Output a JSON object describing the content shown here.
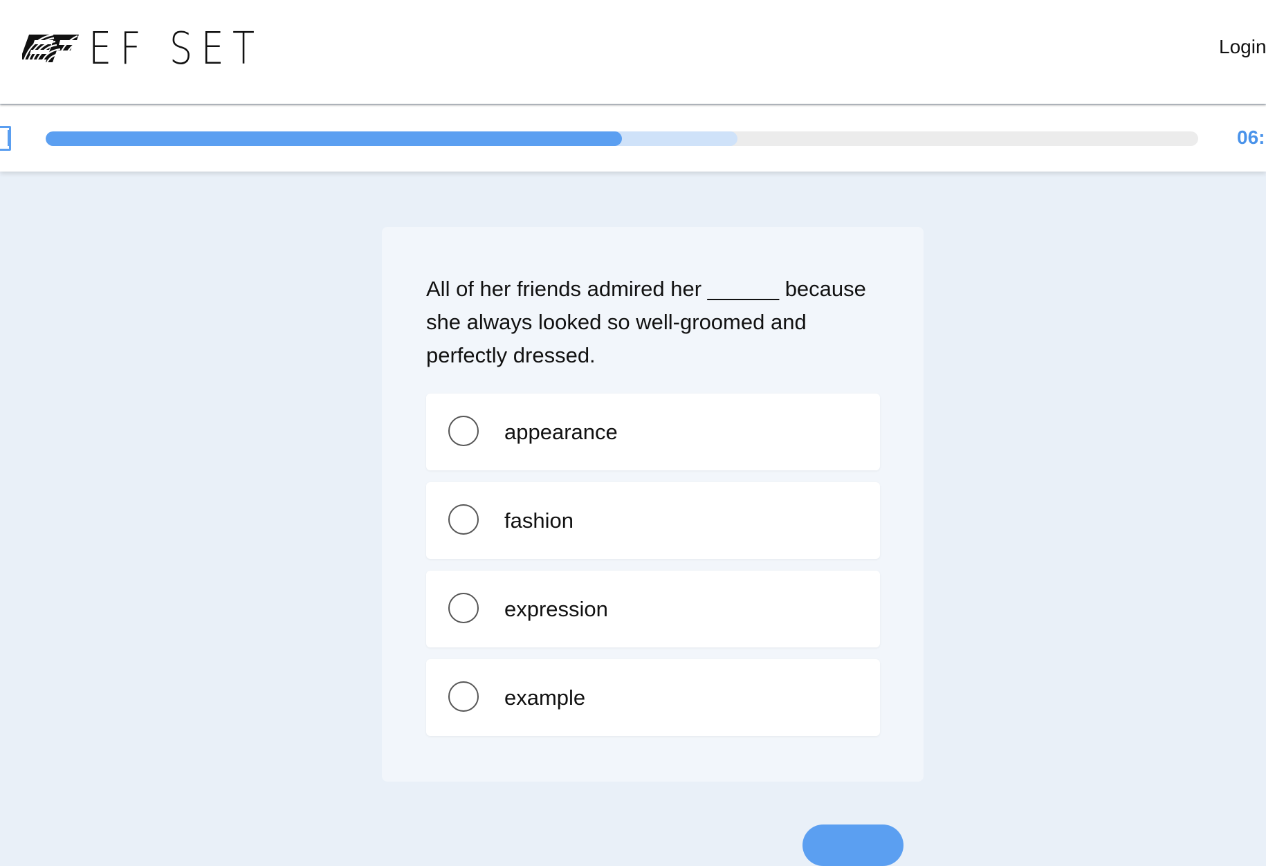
{
  "header": {
    "logo_text": "EF SET",
    "logo_mark": "EF",
    "login_label": "Login"
  },
  "progress": {
    "completed_fraction": 0.5,
    "buffered_fraction": 0.6,
    "timer_text": "06:",
    "colors": {
      "fill": "#5b9ff1",
      "buffer": "#cfe2f9",
      "track": "#ececec",
      "timer": "#4a93ea"
    },
    "side_icon": "book-icon"
  },
  "question": {
    "text": "All of her friends admired her ______ because she always looked so well-groomed and perfectly dressed.",
    "options": [
      {
        "label": "appearance",
        "selected": false
      },
      {
        "label": "fashion",
        "selected": false
      },
      {
        "label": "expression",
        "selected": false
      },
      {
        "label": "example",
        "selected": false
      }
    ]
  },
  "colors": {
    "page_background": "#e9f0f8",
    "accent": "#5b9ff1"
  }
}
